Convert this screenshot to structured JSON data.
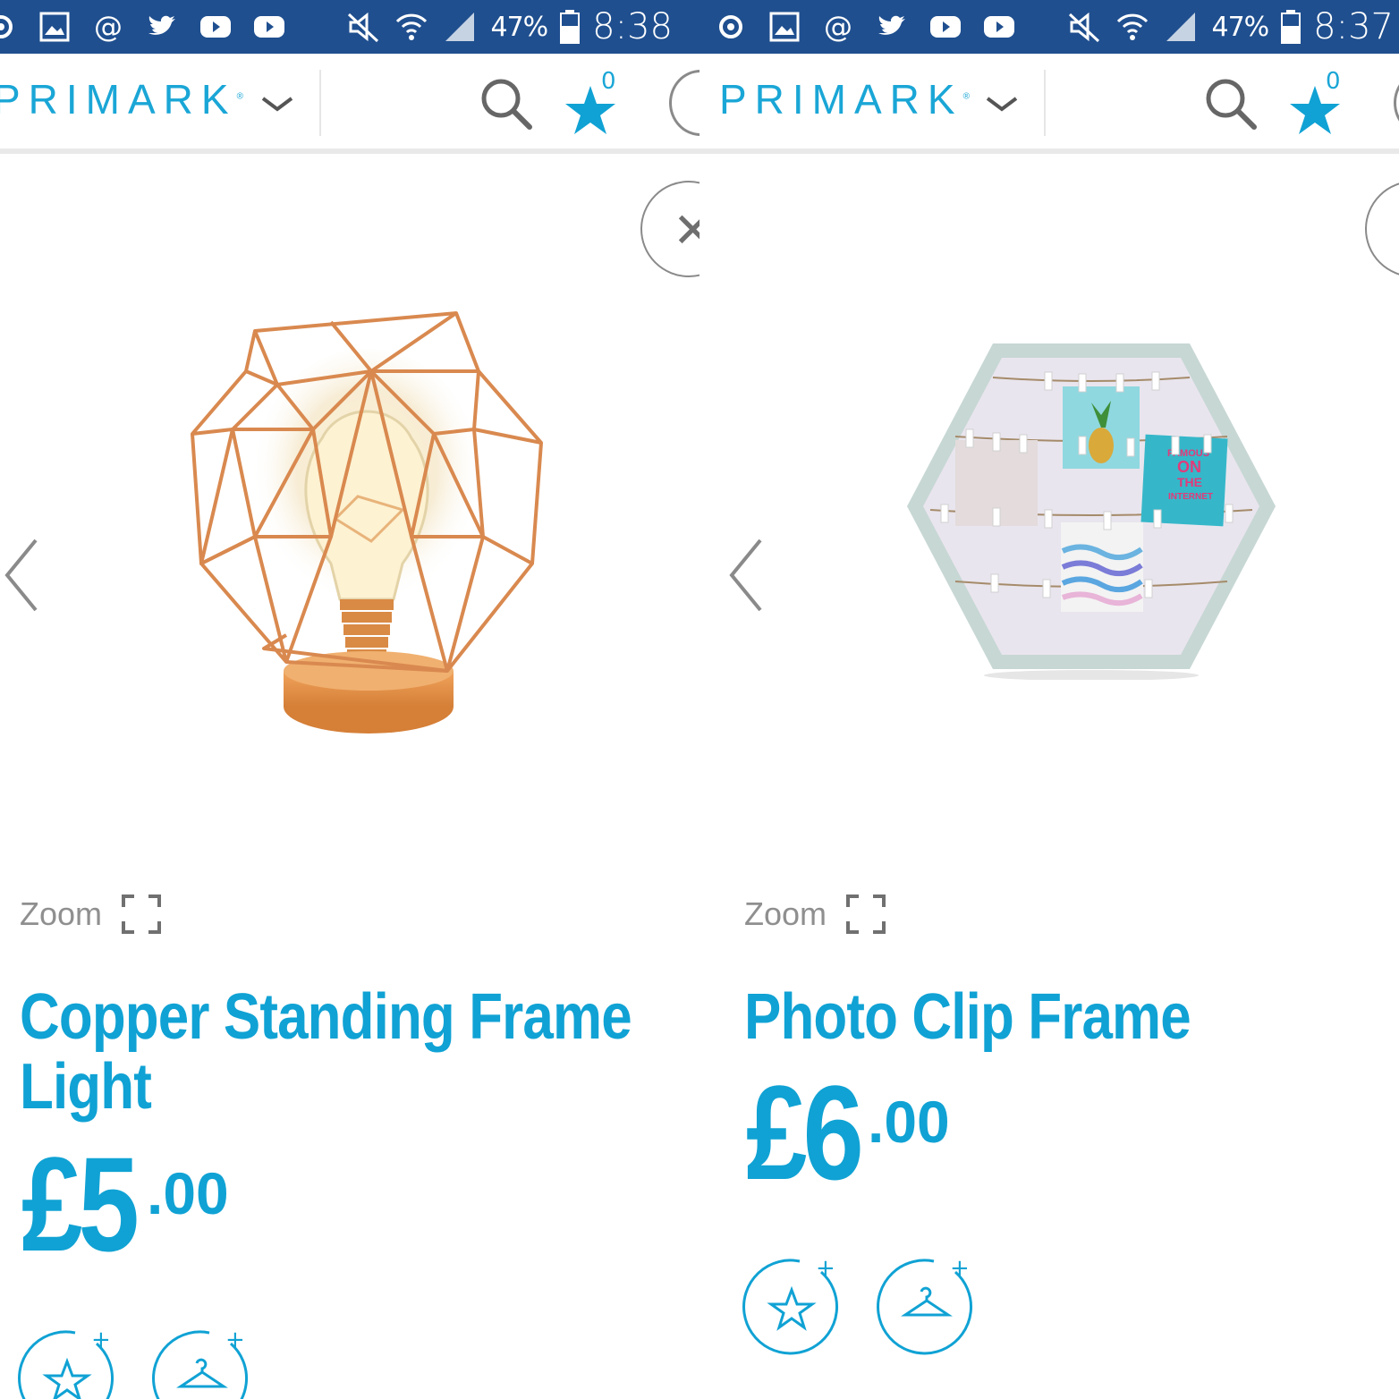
{
  "panels": [
    {
      "status": {
        "battery": "47%",
        "time": "8:38"
      },
      "header": {
        "brand": "PRIMARK",
        "favourites_count": "0"
      },
      "product": {
        "title": "Copper Standing Frame Light",
        "price_main": "£5",
        "price_decimal": ".00",
        "zoom_label": "Zoom"
      }
    },
    {
      "status": {
        "battery": "47%",
        "time": "8:37"
      },
      "header": {
        "brand": "PRIMARK",
        "favourites_count": "0"
      },
      "product": {
        "title": "Photo Clip Frame",
        "price_main": "£6",
        "price_decimal": ".00",
        "zoom_label": "Zoom",
        "print_text": [
          "FAMOUS",
          "ON",
          "THE",
          "INTERNET"
        ]
      }
    }
  ],
  "colors": {
    "accent": "#10a2d4",
    "status_bar": "#1f4f8f",
    "copper": "#d9894f"
  },
  "icons": [
    "wifi-icon",
    "signal-icon",
    "battery-icon",
    "mute-icon",
    "search-icon",
    "star-icon",
    "close-icon",
    "chevron-left-icon",
    "zoom-icon",
    "add-favourite-icon",
    "add-hanger-icon"
  ]
}
